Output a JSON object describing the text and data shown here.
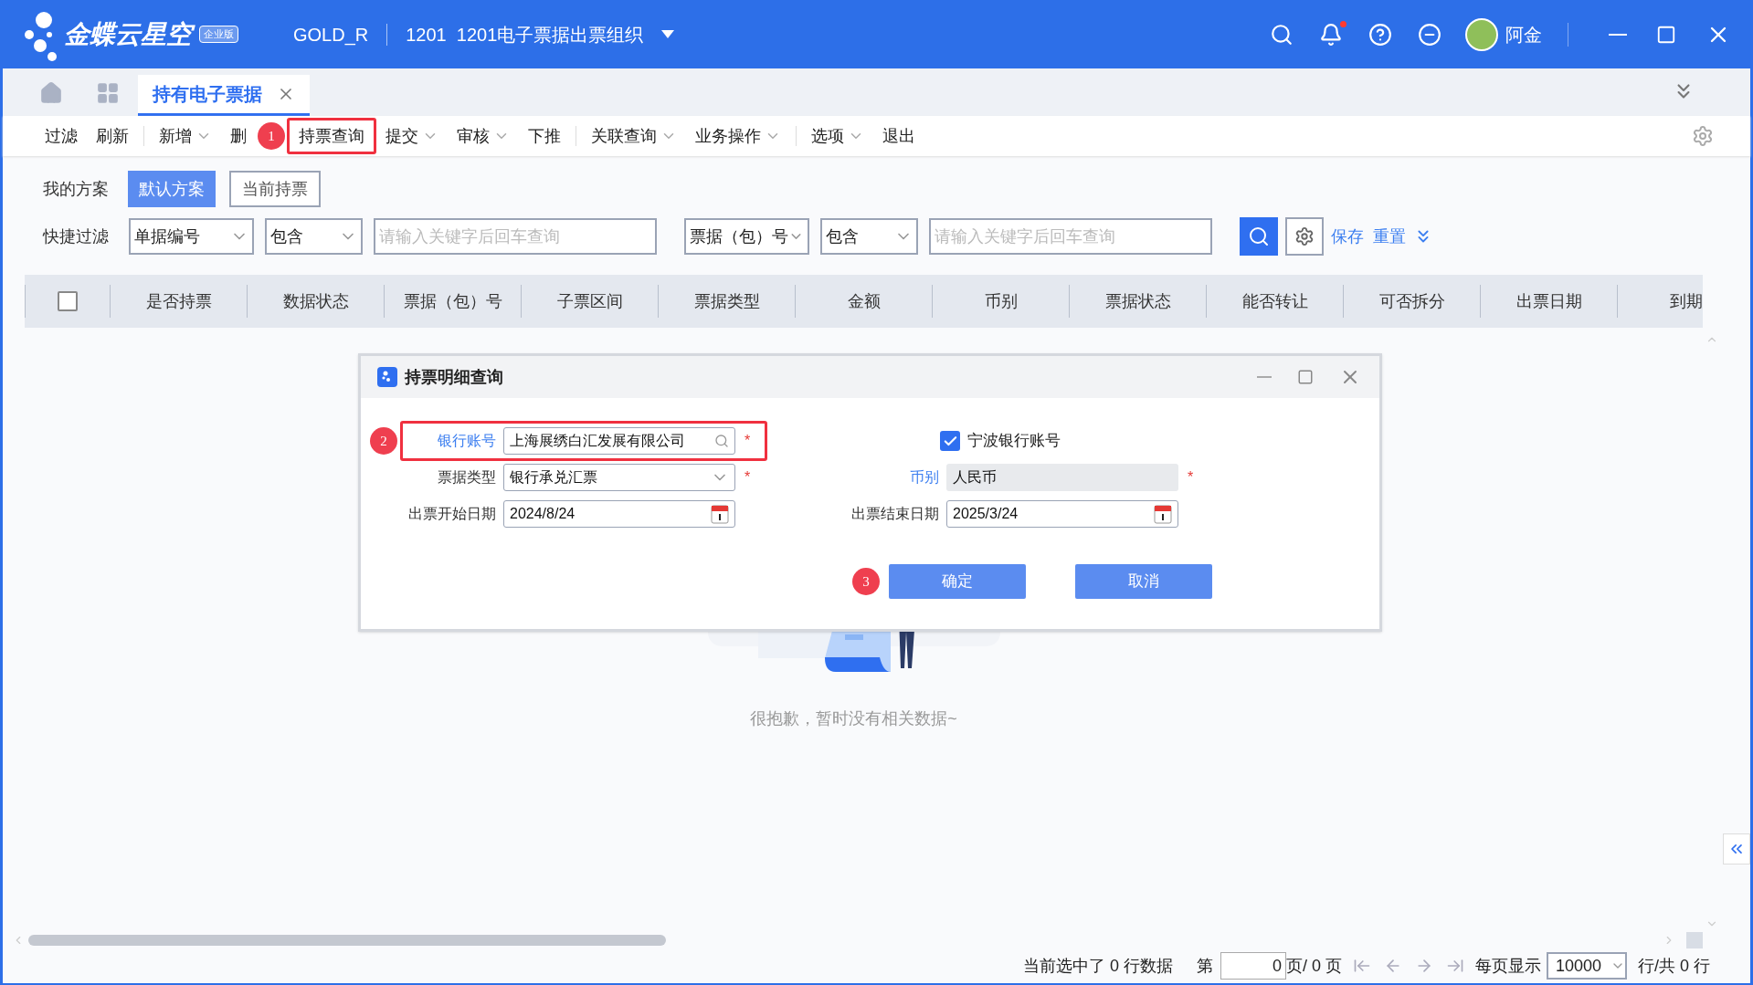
{
  "app": {
    "logo_text": "金蝶云星空",
    "edition_badge": "企业版",
    "data_center": "GOLD_R",
    "org": "1201  1201电子票据出票组织",
    "user": "阿金",
    "notification_dot": true
  },
  "tabs": [
    {
      "label": "持有电子票据",
      "selected": true
    }
  ],
  "toolbar_groups": [
    [
      {
        "label": "过滤",
        "dropdown": false,
        "highlighted": false
      },
      {
        "label": "刷新",
        "dropdown": false,
        "highlighted": false
      }
    ],
    [
      {
        "label": "新增",
        "dropdown": true,
        "highlighted": false
      },
      {
        "label": "删",
        "dropdown": false,
        "highlighted": false
      },
      {
        "label": "持票查询",
        "dropdown": false,
        "highlighted": true,
        "callout": "1"
      },
      {
        "label": "提交",
        "dropdown": true,
        "highlighted": false
      },
      {
        "label": "审核",
        "dropdown": true,
        "highlighted": false
      },
      {
        "label": "下推",
        "dropdown": false,
        "highlighted": false
      }
    ],
    [
      {
        "label": "关联查询",
        "dropdown": true,
        "highlighted": false
      },
      {
        "label": "业务操作",
        "dropdown": true,
        "highlighted": false
      }
    ],
    [
      {
        "label": "选项",
        "dropdown": true,
        "highlighted": false
      },
      {
        "label": "退出",
        "dropdown": false,
        "highlighted": false
      }
    ]
  ],
  "schemes": {
    "label": "我的方案",
    "items": [
      {
        "label": "默认方案",
        "selected": true
      },
      {
        "label": "当前持票",
        "selected": false
      }
    ]
  },
  "quick_filter": {
    "label": "快捷过滤",
    "groups": [
      {
        "field": "单据编号",
        "operator": "包含",
        "placeholder": "请输入关键字后回车查询"
      },
      {
        "field": "票据（包）号",
        "operator": "包含",
        "placeholder": "请输入关键字后回车查询"
      }
    ],
    "save": "保存",
    "reset": "重置"
  },
  "table": {
    "select_all": false,
    "columns": [
      "是否持票",
      "数据状态",
      "票据（包）号",
      "子票区间",
      "票据类型",
      "金额",
      "币别",
      "票据状态",
      "能否转让",
      "可否拆分",
      "出票日期",
      "到期"
    ]
  },
  "empty_state": {
    "text": "很抱歉，暂时没有相关数据~"
  },
  "dialog": {
    "title": "持票明细查询",
    "fields": [
      {
        "kind": "lookup",
        "label": "银行账号",
        "label_link": true,
        "value": "上海展绣白汇发展有限公司",
        "required_mark": "*",
        "highlighted": true,
        "callout": "2"
      },
      {
        "kind": "checkbox",
        "label": "宁波银行账号",
        "checked": true
      },
      {
        "kind": "select",
        "label": "票据类型",
        "label_link": false,
        "value": "银行承兑汇票",
        "required_mark": "*",
        "highlighted": false
      },
      {
        "kind": "readonly",
        "label": "币别",
        "label_link": true,
        "value": "人民币",
        "required_mark": "*",
        "highlighted": false
      },
      {
        "kind": "date",
        "label": "出票开始日期",
        "label_link": false,
        "value": "2024/8/24",
        "highlighted": false
      },
      {
        "kind": "date",
        "label": "出票结束日期",
        "label_link": false,
        "value": "2025/3/24",
        "highlighted": false
      }
    ],
    "buttons": [
      {
        "label": "确定",
        "callout": "3"
      },
      {
        "label": "取消"
      }
    ]
  },
  "pagination": {
    "selected_text": "当前选中了 0 行数据",
    "page_prefix": "第",
    "page_value": "0",
    "page_suffix": "页/ 0 页",
    "per_page_label": "每页显示",
    "per_page_value": "10000",
    "total_text": "行/共 0 行"
  }
}
